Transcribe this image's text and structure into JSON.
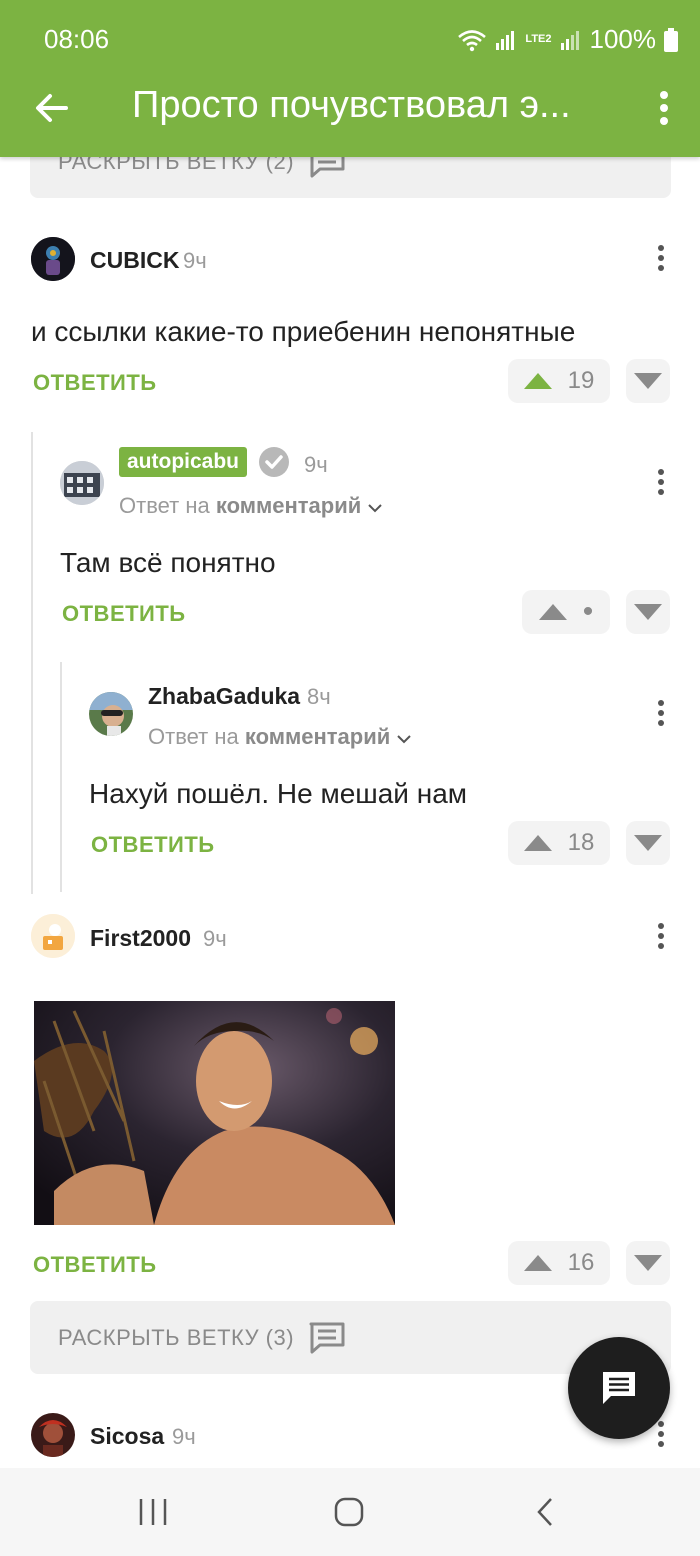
{
  "status_bar": {
    "time": "08:06",
    "battery": "100%",
    "network_label": "LTE2"
  },
  "header": {
    "title": "Просто почувствовал э...",
    "back_icon": "arrow-left-icon",
    "menu_icon": "more-vert-icon"
  },
  "colors": {
    "accent": "#7cb342",
    "text": "#222222",
    "muted": "#9a9a9a",
    "bar_bg": "#f0f0f0",
    "fab": "#1e1e1e"
  },
  "expand_top": {
    "label": "РАСКРЫТЬ ВЕТКУ (2)"
  },
  "comments": [
    {
      "user": "CUBICK",
      "time": "9ч",
      "text": "и ссылки какие-то приебенин непонятные",
      "reply_label": "ОТВЕТИТЬ",
      "rating": "19"
    },
    {
      "user": "autopicabu",
      "time": "9ч",
      "reply_to_prefix": "Ответ на",
      "reply_to_link": "комментарий",
      "text": "Там всё понятно",
      "reply_label": "ОТВЕТИТЬ",
      "rating": "•"
    },
    {
      "user": "ZhabaGaduka",
      "time": "8ч",
      "reply_to_prefix": "Ответ на",
      "reply_to_link": "комментарий",
      "text": "Нахуй пошёл. Не мешай нам",
      "reply_label": "ОТВЕТИТЬ",
      "rating": "18"
    },
    {
      "user": "First2000",
      "time": "9ч",
      "reply_label": "ОТВЕТИТЬ",
      "rating": "16"
    },
    {
      "user": "Sicosa",
      "time": "9ч"
    }
  ],
  "expand_bottom": {
    "label": "РАСКРЫТЬ ВЕТКУ (3)"
  },
  "fab_icon": "comment-icon",
  "nav": {
    "recent_icon": "recent-apps-icon",
    "home_icon": "home-icon",
    "back_icon": "back-chevron-icon"
  }
}
